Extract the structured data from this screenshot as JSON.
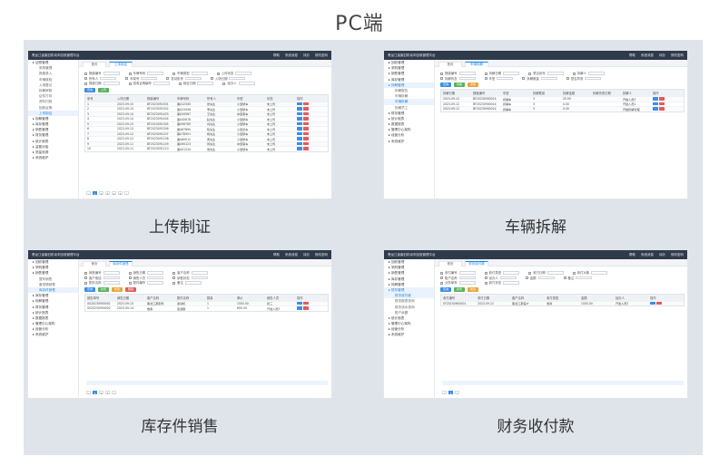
{
  "page_title": "PC端",
  "cards": [
    {
      "caption": "上传制证",
      "app_title": "黑龙江省废旧机动车回收管理平台",
      "tools": [
        "帮助",
        "系统消息",
        "待办",
        "修改密码"
      ],
      "tabs": [
        "首页",
        "上传制证"
      ],
      "sidebar": [
        {
          "label": "证照管理",
          "level": 0,
          "active": false
        },
        {
          "label": "采购管理",
          "level": 1,
          "active": false
        },
        {
          "label": "报废录入",
          "level": 1,
          "active": false
        },
        {
          "label": "车辆核验",
          "level": 1,
          "active": false
        },
        {
          "label": "入场登记",
          "level": 1,
          "active": false
        },
        {
          "label": "拆解审核",
          "level": 1,
          "active": false
        },
        {
          "label": "证件打印",
          "level": 1,
          "active": false
        },
        {
          "label": "资料归档",
          "level": 1,
          "active": false
        },
        {
          "label": "回收证明",
          "level": 1,
          "active": false
        },
        {
          "label": "上传制证",
          "level": 1,
          "active": true
        },
        {
          "label": "拆解管理",
          "level": 0,
          "active": false
        },
        {
          "label": "库存管理",
          "level": 0,
          "active": false
        },
        {
          "label": "销售管理",
          "level": 0,
          "active": false
        },
        {
          "label": "财务管理",
          "level": 0,
          "active": false
        },
        {
          "label": "统计报表",
          "level": 0,
          "active": false
        },
        {
          "label": "监管对接",
          "level": 0,
          "active": false
        },
        {
          "label": "质量追溯",
          "level": 0,
          "active": false
        },
        {
          "label": "系统维护",
          "level": 0,
          "active": false
        }
      ],
      "filters": [
        [
          "报废编号",
          "车牌号码",
          "车辆类型",
          "上传状态"
        ],
        [
          "所有人",
          "车架号",
          "发动机号",
          "入场日期"
        ],
        [
          "报废日期",
          "回收证明编号",
          "制证日期",
          "经办人"
        ]
      ],
      "buttons": [
        "查询",
        "上传"
      ],
      "headers": [
        "序号",
        "入场日期",
        "报废编号",
        "车牌号码",
        "所有人",
        "车型",
        "状态",
        "操作"
      ],
      "rows": [
        [
          "1",
          "2023-09-15",
          "BF2023091501",
          "黑A12345",
          "张先生",
          "小型轿车",
          "未上传",
          ""
        ],
        [
          "2",
          "2023-09-15",
          "BF2023091502",
          "黑A23456",
          "李先生",
          "小型轿车",
          "未上传",
          ""
        ],
        [
          "3",
          "2023-09-14",
          "BF2023091403",
          "黑A34567",
          "王先生",
          "中型客车",
          "未上传",
          ""
        ],
        [
          "4",
          "2023-09-14",
          "BF2023091404",
          "黑A45678",
          "赵先生",
          "小型轿车",
          "未上传",
          ""
        ],
        [
          "5",
          "2023-09-13",
          "BF2023091305",
          "黑A56789",
          "刘先生",
          "小型轿车",
          "未上传",
          ""
        ],
        [
          "6",
          "2023-09-13",
          "BF2023091306",
          "黑A67890",
          "陈先生",
          "小型货车",
          "未上传",
          ""
        ],
        [
          "7",
          "2023-09-12",
          "BF2023091207",
          "黑A78901",
          "杨先生",
          "小型轿车",
          "未上传",
          ""
        ],
        [
          "8",
          "2023-09-12",
          "BF2023091208",
          "黑A89012",
          "黄先生",
          "小型轿车",
          "未上传",
          ""
        ],
        [
          "9",
          "2023-09-11",
          "BF2023091109",
          "黑A90123",
          "周先生",
          "中型客车",
          "未上传",
          ""
        ],
        [
          "10",
          "2023-09-11",
          "BF2023091110",
          "黑A01234",
          "吴先生",
          "小型轿车",
          "未上传",
          ""
        ]
      ],
      "pages": [
        "1",
        "2",
        "3",
        "4",
        "5"
      ]
    },
    {
      "caption": "车辆拆解",
      "app_title": "黑龙江省废旧机动车回收管理平台",
      "tools": [
        "帮助",
        "系统消息",
        "待办",
        "修改密码"
      ],
      "tabs": [
        "首页",
        "车辆拆解"
      ],
      "sidebar": [
        {
          "label": "回收管理",
          "level": 0,
          "active": false
        },
        {
          "label": "采购管理",
          "level": 0,
          "active": false
        },
        {
          "label": "销售管理",
          "level": 0,
          "active": false
        },
        {
          "label": "库存管理",
          "level": 0,
          "active": false
        },
        {
          "label": "拆解管理",
          "level": 0,
          "active": true
        },
        {
          "label": "拆解报告",
          "level": 1,
          "active": false
        },
        {
          "label": "车辆拆解",
          "level": 1,
          "active": false
        },
        {
          "label": "车辆拆解",
          "level": 1,
          "active": true
        },
        {
          "label": "拆解员工",
          "level": 1,
          "active": false
        },
        {
          "label": "财务管理",
          "level": 0,
          "active": false
        },
        {
          "label": "统计报表",
          "level": 0,
          "active": false
        },
        {
          "label": "数据报表",
          "level": 0,
          "active": false
        },
        {
          "label": "管理中心架构",
          "level": 0,
          "active": false
        },
        {
          "label": "经营分析",
          "level": 0,
          "active": false
        },
        {
          "label": "系统维护",
          "level": 0,
          "active": false
        }
      ],
      "filters": [
        [
          "报废编号",
          "拆解日期",
          "是否拆完",
          "拆解人"
        ],
        [
          "拆解状态",
          "车型",
          "拆解数量",
          "是否异常"
        ]
      ],
      "buttons": [
        "查询",
        "拆解",
        "完成"
      ],
      "headers": [
        "拆解日期",
        "报废编号",
        "车型",
        "拆解数量",
        "拆解金额",
        "拆解完成日期",
        "拆解人",
        "操作"
      ],
      "rows": [
        [
          "2023-09-12",
          "BF20230900014",
          "拆解车",
          "3",
          "20.00",
          "",
          "开始人员2",
          ""
        ],
        [
          "2023-09-12",
          "BF20230900014",
          "拆解车",
          "3",
          "0.00",
          "",
          "开始人员2",
          ""
        ],
        [
          "2023-09-12",
          "BF20230900014",
          "拆解车",
          "3",
          "0.00",
          "",
          "开始拆解管理",
          ""
        ]
      ],
      "pages": []
    },
    {
      "caption": "库存件销售",
      "app_title": "黑龙江省废旧机动车回收管理平台",
      "tools": [
        "帮助",
        "系统消息",
        "待办",
        "修改密码"
      ],
      "tabs": [
        "首页",
        "库存件销售"
      ],
      "sidebar": [
        {
          "label": "回收管理",
          "level": 0,
          "active": false
        },
        {
          "label": "采购管理",
          "level": 0,
          "active": false
        },
        {
          "label": "销售管理",
          "level": 0,
          "active": false
        },
        {
          "label": "整车销售",
          "level": 1,
          "active": false
        },
        {
          "label": "废旧物销售",
          "level": 1,
          "active": false
        },
        {
          "label": "库存件销售",
          "level": 1,
          "active": true
        },
        {
          "label": "库存管理",
          "level": 0,
          "active": false
        },
        {
          "label": "拆解管理",
          "level": 0,
          "active": false
        },
        {
          "label": "财务管理",
          "level": 0,
          "active": false
        },
        {
          "label": "统计报表",
          "level": 0,
          "active": false
        },
        {
          "label": "数据报表",
          "level": 0,
          "active": false
        },
        {
          "label": "管理中心架构",
          "level": 0,
          "active": false
        },
        {
          "label": "经营分析",
          "level": 0,
          "active": false
        },
        {
          "label": "系统维护",
          "level": 0,
          "active": false
        }
      ],
      "filters": [
        [
          "销售编号",
          "销售日期",
          "客户名称"
        ],
        [
          "客户电话",
          "销售人员",
          "销售状态"
        ],
        [
          "配件名称",
          "配件编号",
          "备注"
        ]
      ],
      "buttons": [
        "查询",
        "新增",
        "修改",
        "删除"
      ],
      "headers": [
        "销售单号",
        "销售日期",
        "客户名称",
        "配件名称",
        "数量",
        "单价",
        "销售人员",
        "操作"
      ],
      "rows": [
        [
          "XS20230900001",
          "2023-09-13",
          "黑龙江某配件",
          "发动机",
          "1",
          "1500.00",
          "张三",
          ""
        ],
        [
          "XS20230900002",
          "2023-09-14",
          "散客",
          "变速箱",
          "1",
          "800.00",
          "开发人员2",
          ""
        ]
      ],
      "pages": [
        "1",
        "2",
        "3"
      ]
    },
    {
      "caption": "财务收付款",
      "app_title": "黑龙江省废旧机动车回收管理平台",
      "tools": [
        "帮助",
        "系统消息",
        "待办",
        "修改密码"
      ],
      "tabs": [
        "首页",
        "财务收付款"
      ],
      "sidebar": [
        {
          "label": "回收管理",
          "level": 0,
          "active": false
        },
        {
          "label": "采购管理",
          "level": 0,
          "active": false
        },
        {
          "label": "销售管理",
          "level": 0,
          "active": false
        },
        {
          "label": "库存管理",
          "level": 0,
          "active": false
        },
        {
          "label": "拆解管理",
          "level": 0,
          "active": false
        },
        {
          "label": "财务管理",
          "level": 0,
          "active": true
        },
        {
          "label": "财务收付款",
          "level": 1,
          "active": true
        },
        {
          "label": "财务报表查询",
          "level": 1,
          "active": false
        },
        {
          "label": "财务流水查询",
          "level": 1,
          "active": false
        },
        {
          "label": "账户余额",
          "level": 1,
          "active": false
        },
        {
          "label": "统计报表",
          "level": 0,
          "active": false
        },
        {
          "label": "管理中心架构",
          "level": 0,
          "active": false
        },
        {
          "label": "经营分析",
          "level": 0,
          "active": false
        },
        {
          "label": "系统维护",
          "level": 0,
          "active": false
        }
      ],
      "filters": [
        [
          "收付编号",
          "收付类型",
          "收付日期",
          "收付对象"
        ],
        [
          "账户名称",
          "经办人",
          "金额",
          "备注"
        ],
        [
          "业务单号",
          "收付状态"
        ]
      ],
      "buttons": [
        "查询",
        "新增",
        "修改"
      ],
      "headers": [
        "收付编号",
        "收付日期",
        "客户名称",
        "收付类型",
        "金额",
        "经办人",
        "操作"
      ],
      "rows": [
        [
          "SF20230900001",
          "2023-09-12",
          "黑龙江某客户",
          "收款",
          "1000.00",
          "开发人员2",
          ""
        ]
      ],
      "pages": [
        "1"
      ]
    }
  ]
}
